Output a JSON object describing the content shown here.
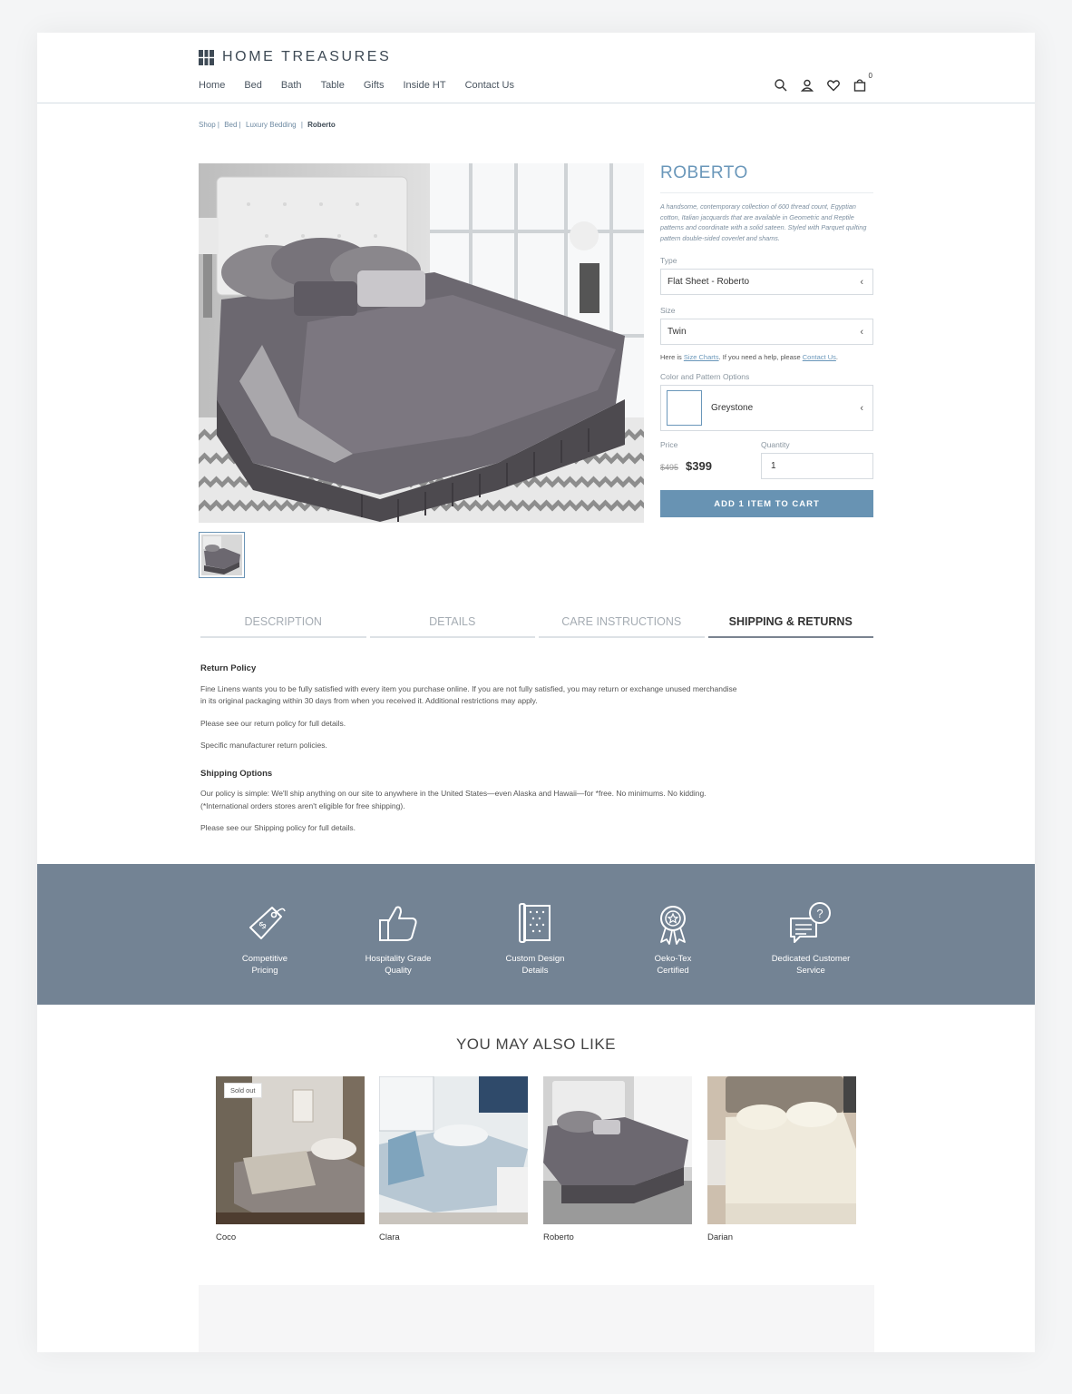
{
  "brand": {
    "name": "HOME TREASURES"
  },
  "nav": {
    "items": [
      "Home",
      "Bed",
      "Bath",
      "Table",
      "Gifts",
      "Inside HT",
      "Contact Us"
    ]
  },
  "header": {
    "cart_count": "0"
  },
  "breadcrumb": {
    "items": [
      "Shop |",
      "Bed  |",
      "Luxury Bedding",
      "|"
    ],
    "current": "Roberto"
  },
  "product": {
    "title": "ROBERTO",
    "description": "A handsome, contemporary collection of 600 thread count, Egyptian cotton, Italian jacquards that are available in Geometric and Reptile patterns and coordinate with a solid sateen. Styled with Parquet quilting pattern double-sided coverlet and shams.",
    "type_label": "Type",
    "type_value": "Flat Sheet - Roberto",
    "size_label": "Size",
    "size_value": "Twin",
    "help_prefix": "Here is ",
    "help_link1": "Size Charts",
    "help_middle": ".  If you need a help, please ",
    "help_link2": "Contact Us",
    "help_suffix": ".",
    "color_label": "Color and Pattern Options",
    "color_value": "Greystone",
    "price_label": "Price",
    "old_price": "$495",
    "new_price": "$399",
    "quantity_label": "Quantity",
    "quantity_value": "1",
    "add_button": "ADD 1 ITEM TO CART"
  },
  "tabs": [
    "DESCRIPTION",
    "DETAILS",
    "CARE INSTRUCTIONS",
    "SHIPPING & RETURNS"
  ],
  "shipping": {
    "return_title": "Return Policy",
    "return_text": "Fine Linens wants you to be fully satisfied with every item you purchase online. If you are not fully satisfied, you may return or exchange unused merchandise in its original packaging within 30 days from when you received it. Additional restrictions may apply.",
    "return_link": "Please see our return policy for full details.",
    "manufacturer": "Specific manufacturer return policies.",
    "shipping_title": "Shipping Options",
    "shipping_text": "Our policy is simple: We'll ship anything on our site to anywhere in the United States—even Alaska and Hawaii—for *free. No minimums. No kidding. (*International orders stores aren't eligible for free shipping).",
    "shipping_link": "Please see our Shipping policy for full details."
  },
  "features": [
    {
      "line1": "Competitive",
      "line2": "Pricing",
      "icon": "price-tag-icon"
    },
    {
      "line1": "Hospitality Grade",
      "line2": "Quality",
      "icon": "thumbs-up-icon"
    },
    {
      "line1": "Custom Design",
      "line2": "Details",
      "icon": "fabric-roll-icon"
    },
    {
      "line1": "Oeko-Tex",
      "line2": "Certified",
      "icon": "award-ribbon-icon"
    },
    {
      "line1": "Dedicated Customer",
      "line2": "Service",
      "icon": "chat-question-icon"
    }
  ],
  "also_like": {
    "title": "YOU MAY ALSO LIKE",
    "items": [
      {
        "name": "Coco",
        "badge": "Sold out"
      },
      {
        "name": "Clara"
      },
      {
        "name": "Roberto"
      },
      {
        "name": "Darian"
      }
    ]
  },
  "colors": {
    "accent": "#6893b3",
    "title": "#6a97ba",
    "band": "#738394"
  }
}
